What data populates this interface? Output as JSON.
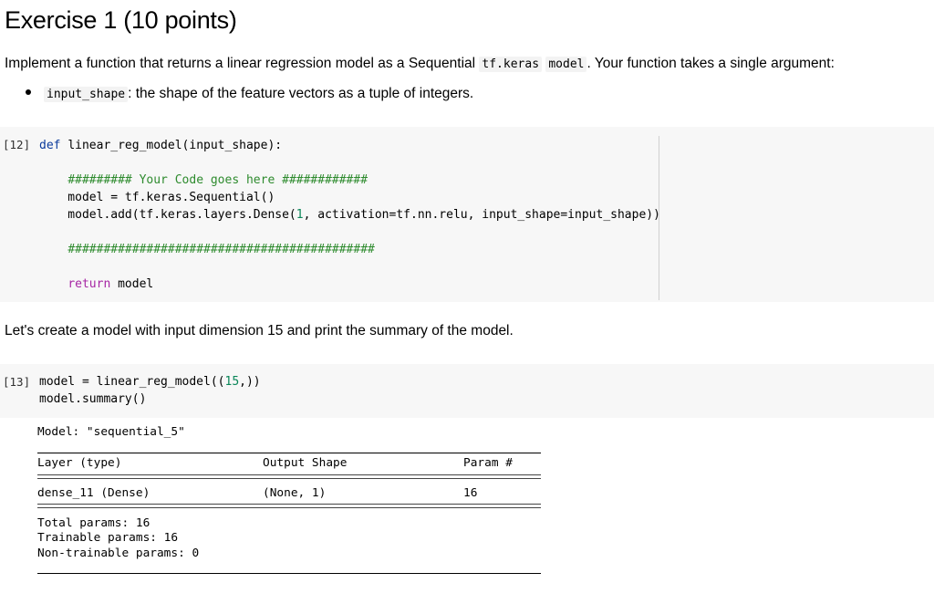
{
  "title": "Exercise 1 (10 points)",
  "intro": {
    "text_before": "Implement a function that returns a linear regression model as a Sequential ",
    "code1": "tf.keras",
    "code2": "model",
    "text_after": ". Your function takes a single argument:"
  },
  "bullet": {
    "code": "input_shape",
    "text": ": the shape of the feature vectors as a tuple of integers."
  },
  "cell1": {
    "prompt": "[12]",
    "lines": [
      "def linear_reg_model(input_shape):",
      "",
      "    ######### Your Code goes here ############",
      "    model = tf.keras.Sequential()",
      "    model.add(tf.keras.layers.Dense(1, activation=tf.nn.relu, input_shape=input_shape))",
      "",
      "    ###########################################",
      "",
      "    return model"
    ]
  },
  "middle_text": "Let's create a model with input dimension 15 and print the summary of the model.",
  "cell2": {
    "prompt": "[13]",
    "lines": [
      "model = linear_reg_model((15,))",
      "model.summary()"
    ]
  },
  "summary": {
    "model_line": "Model: \"sequential_5\"",
    "headers": [
      "Layer (type)",
      "Output Shape",
      "Param #"
    ],
    "row": [
      "dense_11 (Dense)",
      "(None, 1)",
      "16"
    ],
    "total": "Total params: 16",
    "trainable": "Trainable params: 16",
    "non_trainable": "Non-trainable params: 0"
  }
}
